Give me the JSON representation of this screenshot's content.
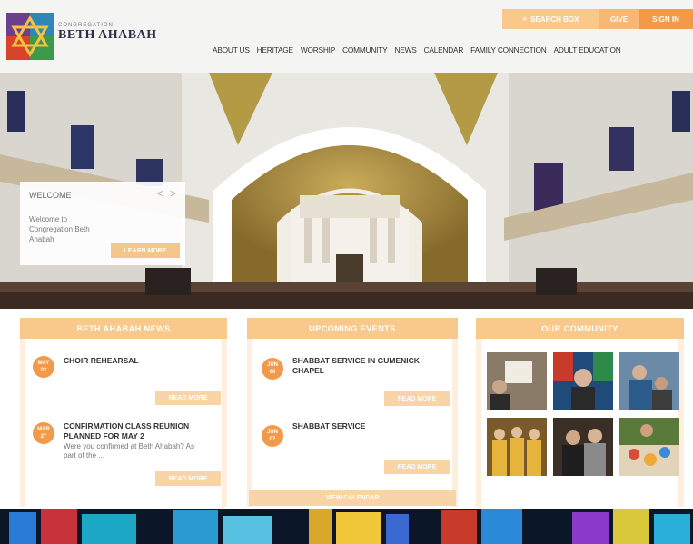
{
  "header": {
    "logo_sub": "Congregation",
    "logo_name": "BETH AHABAH",
    "search_label": "SEARCH BOX",
    "give_label": "GIVE",
    "signin_label": "SIGN IN"
  },
  "nav": [
    "ABOUT US",
    "HERITAGE",
    "WORSHIP",
    "COMMUNITY",
    "NEWS",
    "CALENDAR",
    "FAMILY CONNECTION",
    "ADULT EDUCATION"
  ],
  "welcome": {
    "title": "WELCOME",
    "arrows": "< >",
    "text": "Welcome to Congregation Beth Ahabah",
    "button": "LEARN MORE"
  },
  "news": {
    "heading": "BETH AHABAH NEWS",
    "items": [
      {
        "date_month": "MAY",
        "date_day": "02",
        "title": "CHOIR REHEARSAL",
        "desc": "",
        "button": "READ MORE"
      },
      {
        "date_month": "MAR",
        "date_day": "27",
        "title": "CONFIRMATION CLASS REUNION PLANNED FOR MAY 2",
        "desc": "Were you confirmed at Beth Ahabah? As part of the ...",
        "button": "READ MORE"
      }
    ]
  },
  "events": {
    "heading": "UPCOMING EVENTS",
    "items": [
      {
        "date_month": "JUN",
        "date_day": "06",
        "title": "SHABBAT SERVICE IN GUMENICK CHAPEL",
        "button": "READ MORE"
      },
      {
        "date_month": "JUN",
        "date_day": "07",
        "title": "SHABBAT SERVICE",
        "button": "READ MORE"
      }
    ],
    "view_all": "VIEW CALENDAR"
  },
  "community": {
    "heading": "OUR COMMUNITY"
  },
  "colors": {
    "accent": "#f39a4a",
    "accent_light": "#f8c98a",
    "accent_pale": "#fdeede"
  },
  "icons": {
    "search": "search-icon"
  }
}
